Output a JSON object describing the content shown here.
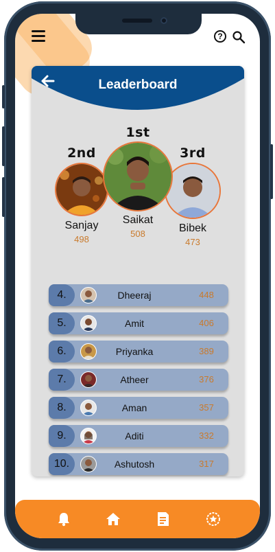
{
  "header": {
    "help_glyph": "?"
  },
  "leaderboard": {
    "title": "Leaderboard",
    "podium": [
      {
        "rank": "1st",
        "name": "Saikat",
        "score": "508"
      },
      {
        "rank": "2nd",
        "name": "Sanjay",
        "score": "498"
      },
      {
        "rank": "3rd",
        "name": "Bibek",
        "score": "473"
      }
    ],
    "list": [
      {
        "rank": "4.",
        "name": "Dheeraj",
        "score": "448"
      },
      {
        "rank": "5.",
        "name": "Amit",
        "score": "406"
      },
      {
        "rank": "6.",
        "name": "Priyanka",
        "score": "389"
      },
      {
        "rank": "7.",
        "name": "Atheer",
        "score": "376"
      },
      {
        "rank": "8.",
        "name": "Aman",
        "score": "357"
      },
      {
        "rank": "9.",
        "name": "Aditi",
        "score": "332"
      },
      {
        "rank": "10.",
        "name": "Ashutosh",
        "score": "317"
      }
    ]
  },
  "bottom_nav": {
    "icons": [
      "bell-icon",
      "home-icon",
      "document-icon",
      "badge-icon"
    ]
  },
  "colors": {
    "accent": "#f78a25",
    "header_blue": "#0a4e8c",
    "row_blue": "#95a9c7",
    "rank_blue": "#5c7baa",
    "score_orange": "#c97a2c"
  }
}
